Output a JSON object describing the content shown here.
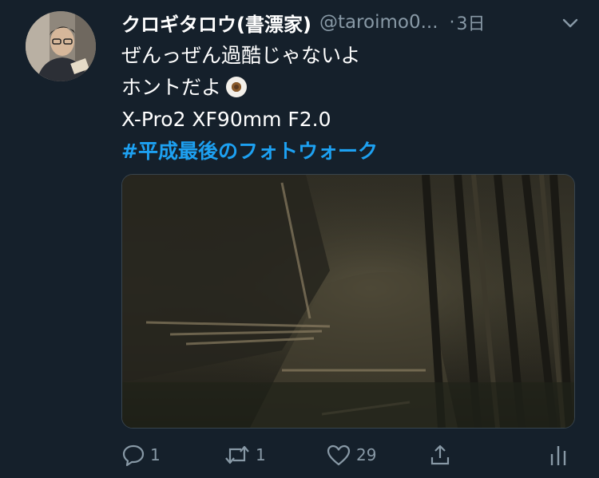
{
  "tweet": {
    "display_name": "クロギタロウ(書漂家)",
    "handle": "@taroimo0...",
    "separator": "·",
    "time": "3日",
    "lines": [
      "ぜんっぜん過酷じゃないよ",
      "ホントだよ",
      "X-Pro2 XF90mm F2.0"
    ],
    "hashtag": "#平成最後のフォトウォーク"
  },
  "actions": {
    "reply_count": "1",
    "retweet_count": "1",
    "like_count": "29"
  },
  "icons": [
    "avatar",
    "chevron-down-icon",
    "eye-emoji-icon",
    "reply-icon",
    "retweet-icon",
    "like-icon",
    "share-icon",
    "analytics-icon"
  ],
  "colors": {
    "background": "#15202b",
    "secondary_text": "#8899a6",
    "hashtag": "#1da1f2"
  }
}
